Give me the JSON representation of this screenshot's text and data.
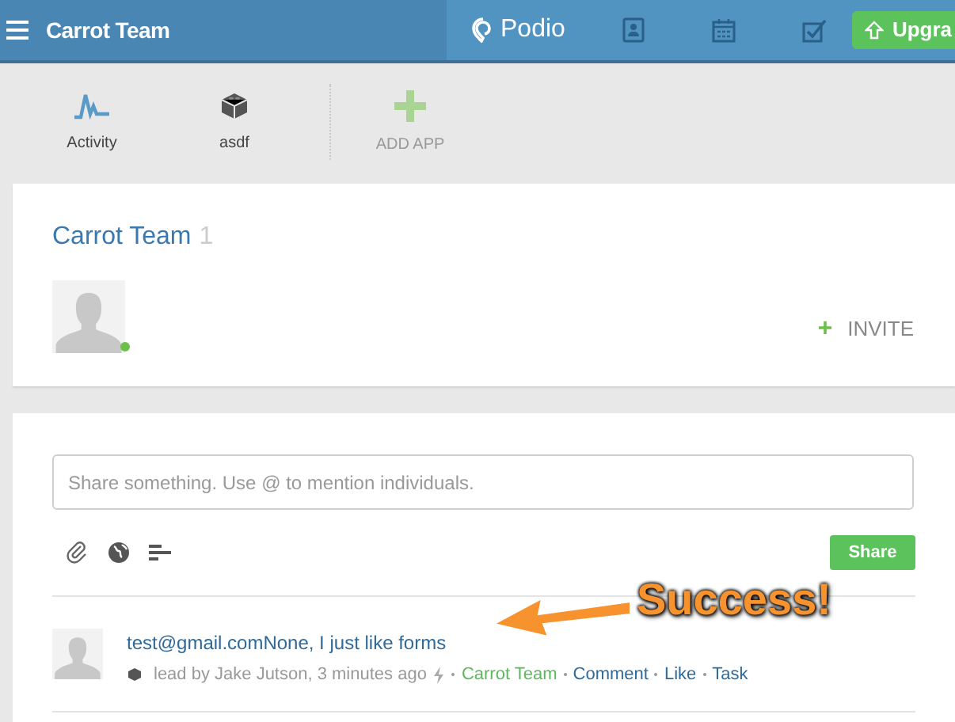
{
  "topbar": {
    "title": "Carrot Team",
    "brand": "Podio",
    "nav_icons": [
      {
        "kind": "contacts"
      },
      {
        "kind": "calendar"
      },
      {
        "kind": "tasks"
      }
    ],
    "upgrade": "Upgra"
  },
  "apps": [
    {
      "label": "Activity",
      "kind": "activity"
    },
    {
      "label": "asdf",
      "kind": "app"
    },
    {
      "label": "ADD APP",
      "kind": "add"
    }
  ],
  "workspace": {
    "name": "Carrot Team",
    "member_count": "1",
    "member_online": true,
    "invite": "INVITE"
  },
  "composer": {
    "placeholder": "Share something. Use @ to mention individuals.",
    "share": "Share"
  },
  "post": {
    "title": "test@gmail.comNone, I just like forms",
    "meta": "lead by Jake Jutson, 3 minutes ago",
    "workspace": "Carrot Team",
    "actions": [
      "Comment",
      "Like",
      "Task"
    ]
  },
  "annotation": {
    "text": "Success!"
  }
}
